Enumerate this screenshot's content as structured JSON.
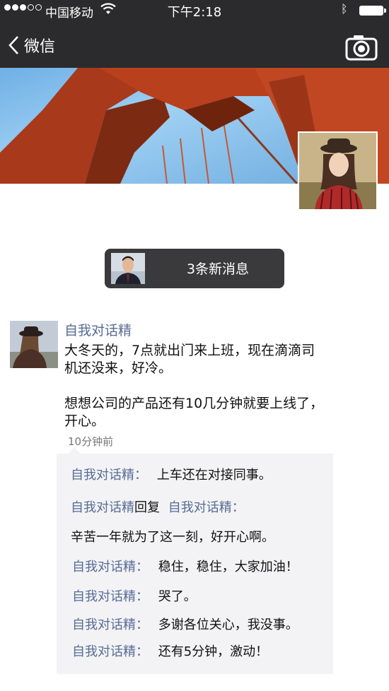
{
  "status_bar": {
    "carrier": "中国移动",
    "time": "下午2:18"
  },
  "nav": {
    "back_label": "微信",
    "camera_icon": "camera-icon"
  },
  "new_messages": {
    "label": "3条新消息"
  },
  "post": {
    "author": "自我对话精",
    "paragraphs": [
      "大冬天的，7点就出门来上班，现在滴滴司机还没来，好冷。",
      "想想公司的产品还有10几分钟就要上线了，开心。"
    ],
    "time_ago": "10分钟前"
  },
  "comments": [
    {
      "name": "自我对话精",
      "sep": "：",
      "text": "上车还在对接同事。"
    },
    {
      "name": "自我对话精",
      "reply_word": "回复",
      "reply_to": "自我对话精",
      "sep": "："
    },
    {
      "text": "辛苦一年就为了这一刻，好开心啊。"
    },
    {
      "name": "自我对话精",
      "sep": "：",
      "text": "稳住，稳住，大家加油！"
    },
    {
      "name": "自我对话精",
      "sep": "：",
      "text": "哭了。"
    },
    {
      "name": "自我对话精",
      "sep": "：",
      "text": "多谢各位关心，我没事。"
    },
    {
      "name": "自我对话精",
      "sep": "：",
      "text": "还有5分钟，激动！"
    }
  ],
  "colors": {
    "nav_bg": "#2b2b2d",
    "link": "#576b95",
    "comment_bg": "#f3f3f5"
  }
}
